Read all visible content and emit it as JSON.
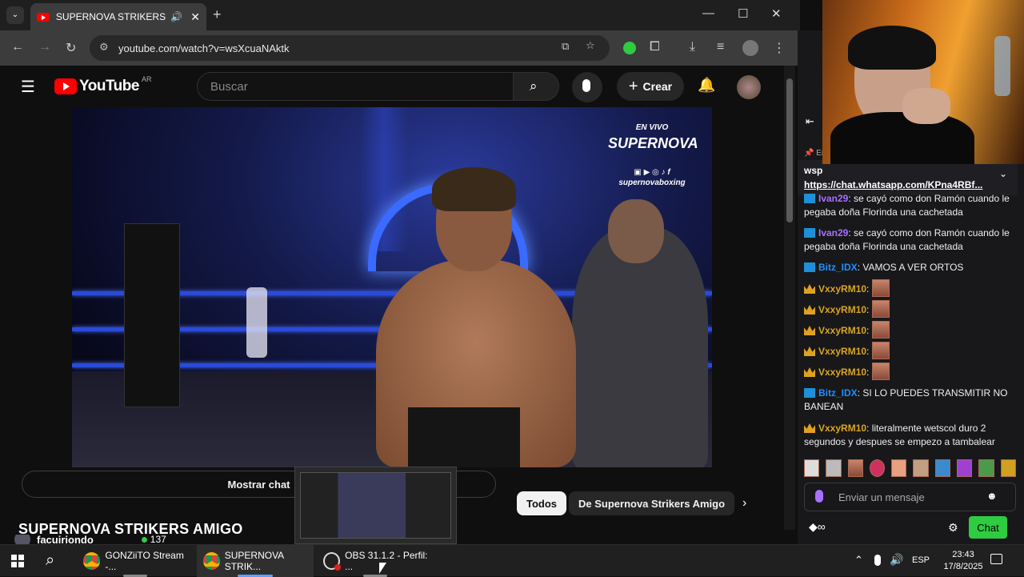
{
  "browser": {
    "tab_title": "SUPERNOVA STRIKERS AMI",
    "url": "youtube.com/watch?v=wsXcuaNAktk"
  },
  "youtube": {
    "logo_text": "YouTube",
    "region": "AR",
    "search_placeholder": "Buscar",
    "create_label": "Crear",
    "show_chat": "Mostrar chat",
    "chip_all": "Todos",
    "chip_channel": "De Supernova Strikers Amigo",
    "video_title": "SUPERNOVA STRIKERS AMIGO",
    "channel": "facuiriondo",
    "viewers": "137",
    "overlay": {
      "live": "EN VIVO",
      "brand": "SUPERNOVA",
      "handle": "supernovaboxing"
    }
  },
  "chat": {
    "pinned_title": "wsp",
    "pinned_link": "https://chat.whatsapp.com/KPna4RBf...",
    "pinned_prefix": "En",
    "messages": [
      {
        "badge": "bolt",
        "user": "Ivan29",
        "color": "#a970ff",
        "text": "se cayó como don Ramón cuando le pegaba doña Florinda una cachetada"
      },
      {
        "badge": "bolt",
        "user": "Ivan29",
        "color": "#a970ff",
        "text": "se cayó como don Ramón cuando le pegaba doña Florinda una cachetada"
      },
      {
        "badge": "bolt",
        "user": "Bitz_IDX",
        "color": "#1e90ff",
        "text": "VAMOS A VER ORTOS"
      },
      {
        "badge": "crown",
        "user": "VxxyRM10",
        "color": "#daa520",
        "text": ""
      },
      {
        "badge": "crown",
        "user": "VxxyRM10",
        "color": "#daa520",
        "text": ""
      },
      {
        "badge": "crown",
        "user": "VxxyRM10",
        "color": "#daa520",
        "text": ""
      },
      {
        "badge": "crown",
        "user": "VxxyRM10",
        "color": "#daa520",
        "text": ""
      },
      {
        "badge": "crown",
        "user": "VxxyRM10",
        "color": "#daa520",
        "text": ""
      },
      {
        "badge": "bolt",
        "user": "Bitz_IDX",
        "color": "#1e90ff",
        "text": "SI LO PUEDES TRANSMITIR NO BANEAN"
      },
      {
        "badge": "crown",
        "user": "VxxyRM10",
        "color": "#daa520",
        "text": "literalmente wetscol duro 2 segundos y despues se empezo a tambalear"
      }
    ],
    "input_placeholder": "Enviar un mensaje",
    "chat_button": "Chat"
  },
  "taskbar": {
    "items": [
      {
        "label": "GONZiiTO Stream -...",
        "icon": "chrome-icon"
      },
      {
        "label": "SUPERNOVA STRIK...",
        "icon": "chrome-icon"
      },
      {
        "label": "OBS 31.1.2 - Perfil: ...",
        "icon": "obs-icon"
      }
    ],
    "lang": "ESP",
    "time": "23:43",
    "date": "17/8/2025"
  }
}
